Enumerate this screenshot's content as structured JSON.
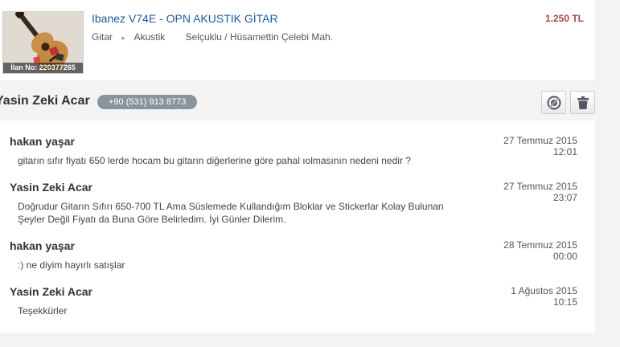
{
  "listing": {
    "title": "Ibanez V74E - OPN AKUSTIK GİTAR",
    "price": "1.250 TL",
    "ad_number": "İlan No: 220377265",
    "breadcrumbs": [
      "Gitar",
      "Akustik"
    ],
    "location": "Selçuklu / Hüsamettin Çelebi Mah."
  },
  "contact": {
    "name": "Yasin Zeki Acar",
    "phone": "+90 (531) 913 8773"
  },
  "actions": {
    "block_icon": "block-user-icon",
    "delete_icon": "trash-icon"
  },
  "messages": [
    {
      "sender": "hakan yaşar",
      "text": "gitarın sıfır fiyatı 650 lerde hocam bu gitarın diğerlerine göre pahal ıolmasının nedeni nedir ?",
      "date": "27 Temmuz 2015",
      "time": "12:01"
    },
    {
      "sender": "Yasin Zeki Acar",
      "text": "Doğrudur Gitarın Sıfırı 650-700 TL Ama Süslemede Kullandığım Bloklar ve Stickerlar Kolay Bulunan Şeyler Değil Fiyatı da Buna Göre Belirledim. İyi Günler Dilerim.",
      "date": "27 Temmuz 2015",
      "time": "23:07"
    },
    {
      "sender": "hakan yaşar",
      "text": ":) ne diyim hayırlı satışlar",
      "date": "28 Temmuz 2015",
      "time": "00:00"
    },
    {
      "sender": "Yasin Zeki Acar",
      "text": "Teşekkürler",
      "date": "1 Ağustos 2015",
      "time": "10:15"
    }
  ]
}
